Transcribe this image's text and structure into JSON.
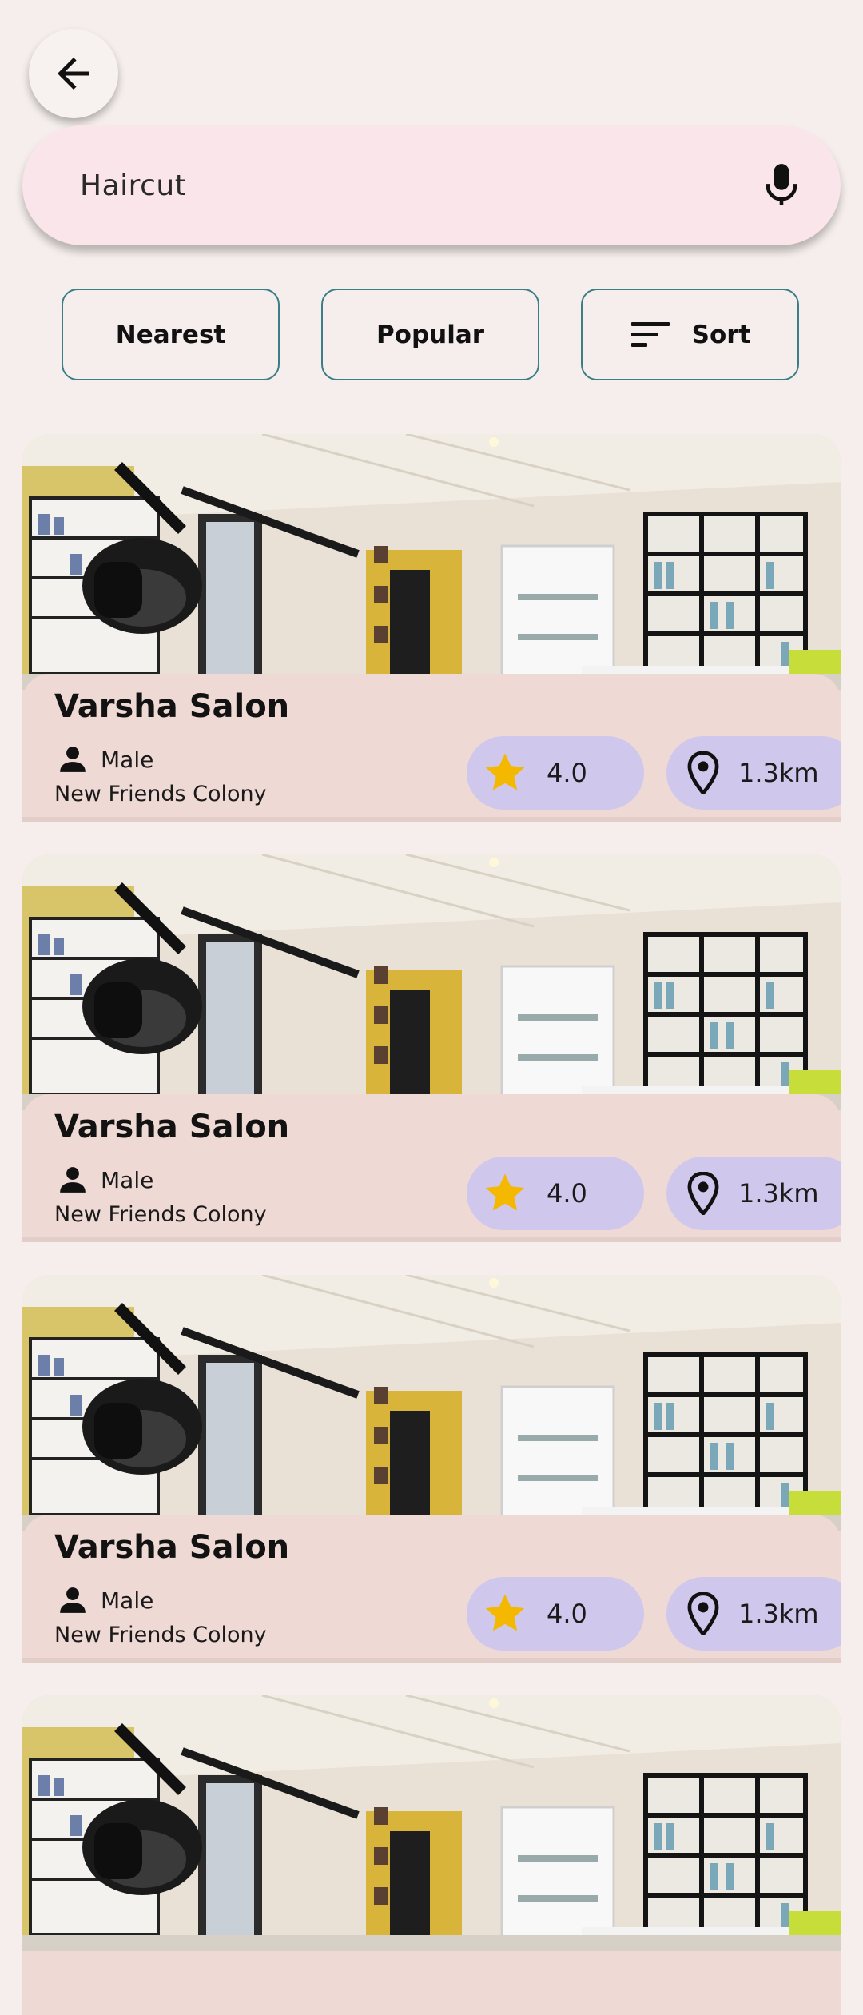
{
  "search": {
    "query": "Haircut"
  },
  "filters": {
    "nearest_label": "Nearest",
    "popular_label": "Popular",
    "sort_label": "Sort"
  },
  "colors": {
    "background": "#f5eeec",
    "search_bg": "#fae5ea",
    "filter_border": "#3b7f86",
    "card_info_bg": "#efd9d4",
    "pill_bg": "#cfc8ec",
    "star": "#f5b800"
  },
  "icons": {
    "back": "arrow-left-icon",
    "mic": "microphone-icon",
    "sort": "sort-lines-icon",
    "gender": "person-icon",
    "rating": "star-icon",
    "distance": "location-pin-icon"
  },
  "salons": [
    {
      "name": "Varsha Salon",
      "gender": "Male",
      "location": "New Friends Colony",
      "rating": "4.0",
      "distance": "1.3km"
    },
    {
      "name": "Varsha Salon",
      "gender": "Male",
      "location": "New Friends Colony",
      "rating": "4.0",
      "distance": "1.3km"
    },
    {
      "name": "Varsha Salon",
      "gender": "Male",
      "location": "New Friends Colony",
      "rating": "4.0",
      "distance": "1.3km"
    },
    {
      "name": "",
      "gender": "",
      "location": "",
      "rating": "",
      "distance": ""
    }
  ]
}
